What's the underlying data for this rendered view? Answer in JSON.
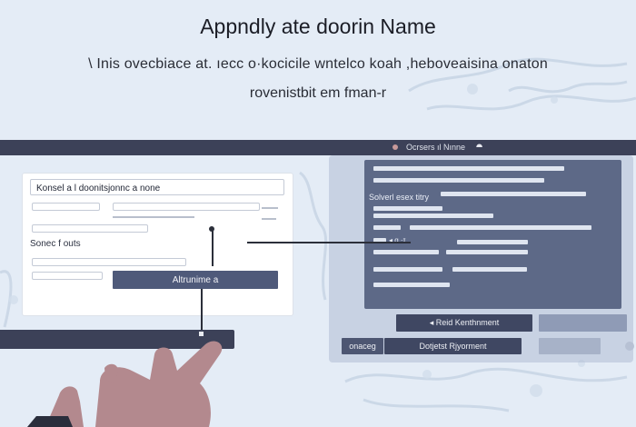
{
  "header": {
    "title": "Appndly ate doorin Name",
    "subtitle": "\\ Inis ovecbiace at. ıecc o·kocicile wntelco koah ,heboveaisina onaton",
    "subtitle2": "rovenistbit em fman-r"
  },
  "window_bar": {
    "title": "Ocrsers ıl Nınne"
  },
  "form": {
    "field_value": "Konsel a l doonitsjonnc a none",
    "section_label": "Sonec f outs",
    "submit_label": "Altrunime a"
  },
  "right_panel": {
    "label": "Solverl esex titry",
    "mark": "◂ ɑ ·ɪ"
  },
  "buttons": {
    "primary_right": "◂ Reid  Kenthnment",
    "bottom_right": "Dotjetst Rjyorment",
    "bottom_left_tab": "onaceg"
  },
  "colors": {
    "bar": "#3c4158",
    "panel": "#5d6987",
    "accent_button": "#4f5a7a",
    "background": "#e4ecf6"
  },
  "icons": [
    "dot-icon",
    "pin-icon",
    "hand-icon"
  ]
}
